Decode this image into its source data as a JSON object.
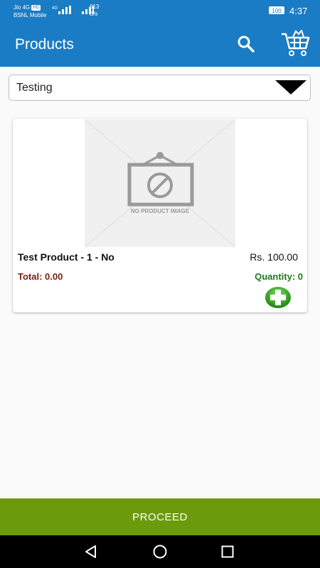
{
  "status_bar": {
    "carrier_line1": "Jio 4G",
    "carrier_badge": "HD",
    "carrier_line2": "BSNL Mobile",
    "net_type": "4G",
    "speed_value": "613",
    "speed_unit": "B/s",
    "battery": "100",
    "time": "4:37"
  },
  "app_bar": {
    "title": "Products",
    "search_icon": "search-icon",
    "cart_icon": "cart-icon"
  },
  "spinner": {
    "selected": "Testing"
  },
  "product": {
    "image_placeholder": "NO PRODUCT IMAGE",
    "name": "Test Product - 1 - No",
    "price": "Rs. 100.00",
    "total": "Total: 0.00",
    "quantity": "Quantity: 0"
  },
  "footer": {
    "proceed_label": "PROCEED"
  },
  "colors": {
    "primary": "#1a7cc4",
    "proceed": "#6b9a0c",
    "total": "#7a1f12",
    "quantity": "#1f7a1f"
  }
}
